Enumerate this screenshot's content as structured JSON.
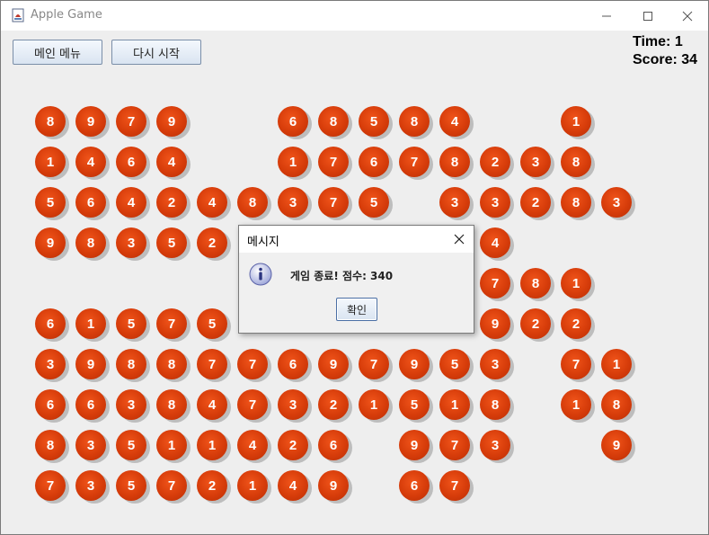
{
  "window": {
    "title": "Apple Game"
  },
  "buttons": {
    "main_menu": "메인 메뉴",
    "restart": "다시 시작"
  },
  "hud": {
    "time": "Time: 1",
    "score": "Score: 34"
  },
  "board": {
    "rows": [
      [
        8,
        9,
        7,
        9,
        null,
        null,
        6,
        8,
        5,
        8,
        4,
        null,
        null,
        1,
        null
      ],
      [
        1,
        4,
        6,
        4,
        null,
        null,
        1,
        7,
        6,
        7,
        8,
        2,
        3,
        8,
        null
      ],
      [
        5,
        6,
        4,
        2,
        4,
        8,
        3,
        7,
        5,
        null,
        3,
        3,
        2,
        8,
        3
      ],
      [
        9,
        8,
        3,
        5,
        2,
        null,
        null,
        null,
        null,
        null,
        null,
        4,
        null,
        null,
        null
      ],
      [
        null,
        null,
        null,
        null,
        null,
        null,
        null,
        null,
        null,
        null,
        null,
        7,
        8,
        1,
        null
      ],
      [
        6,
        1,
        5,
        7,
        5,
        null,
        null,
        null,
        null,
        null,
        null,
        9,
        2,
        2,
        null
      ],
      [
        3,
        9,
        8,
        8,
        7,
        7,
        6,
        9,
        7,
        9,
        5,
        3,
        null,
        7,
        1
      ],
      [
        6,
        6,
        3,
        8,
        4,
        7,
        3,
        2,
        1,
        5,
        1,
        8,
        null,
        1,
        8
      ],
      [
        8,
        3,
        5,
        1,
        1,
        4,
        2,
        6,
        null,
        9,
        7,
        3,
        null,
        null,
        9
      ],
      [
        7,
        3,
        5,
        7,
        2,
        1,
        4,
        9,
        null,
        6,
        7,
        null,
        null,
        null,
        null
      ]
    ]
  },
  "dialog": {
    "title": "메시지",
    "message": "게임 종료! 점수: 340",
    "ok_label": "확인"
  }
}
